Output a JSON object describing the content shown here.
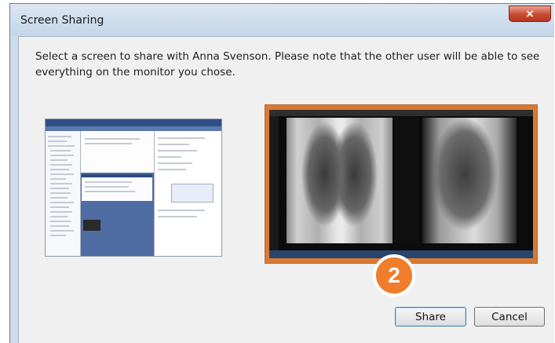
{
  "window": {
    "title": "Screen Sharing",
    "close_icon": "×"
  },
  "message": "Select a screen to share with Anna Svenson.  Please note that the other user will be able to see everything on the monitor you chose.",
  "monitors": [
    {
      "name": "monitor-1",
      "selected": false
    },
    {
      "name": "monitor-2",
      "selected": true,
      "highlight_color": "#d97a34"
    }
  ],
  "step_badge": {
    "number": "2",
    "color": "#ef7d2a"
  },
  "buttons": {
    "share_label": "Share",
    "cancel_label": "Cancel"
  }
}
